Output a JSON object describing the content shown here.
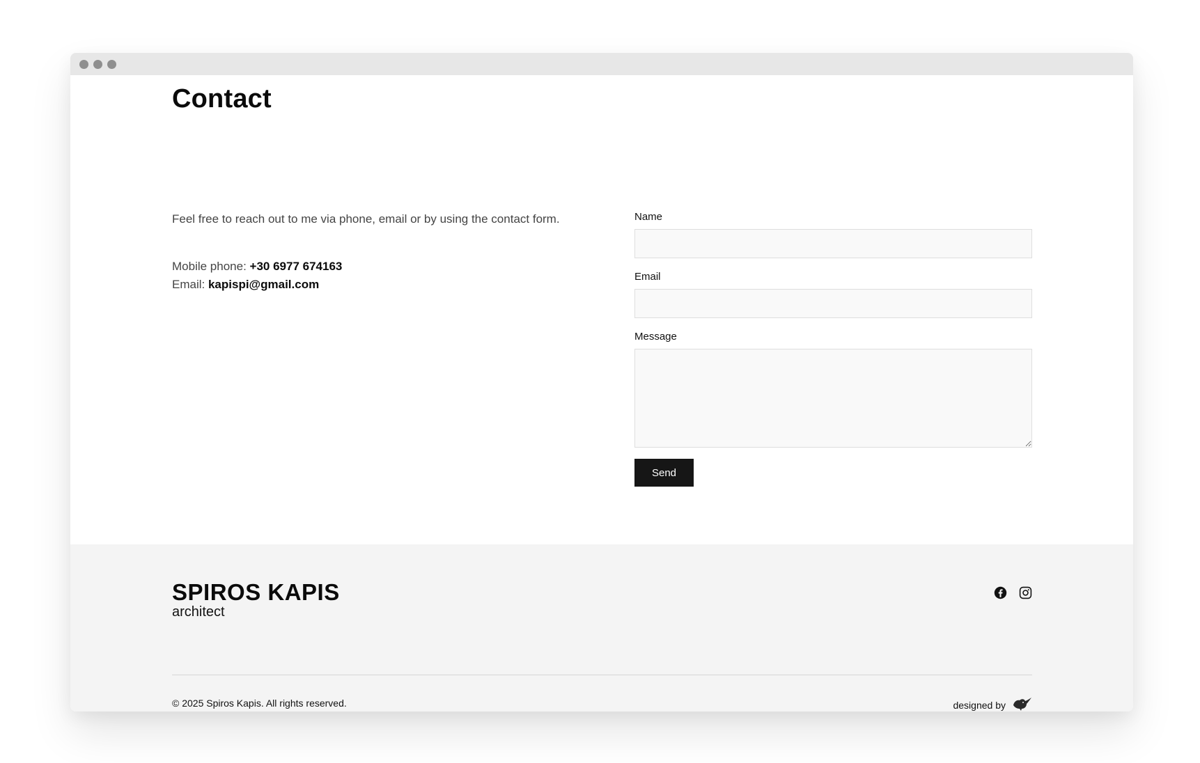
{
  "page": {
    "title": "Contact",
    "intro": "Feel free to reach out to me via phone, email or by using the contact form.",
    "phone_label": "Mobile phone:",
    "phone_value": "+30 6977 674163",
    "email_label": "Email:",
    "email_value": "kapispi@gmail.com"
  },
  "form": {
    "name_label": "Name",
    "name_value": "",
    "email_label": "Email",
    "email_value": "",
    "message_label": "Message",
    "message_value": "",
    "send_label": "Send"
  },
  "footer": {
    "brand_name": "SPIROS KAPIS",
    "brand_sub": "architect",
    "socials": [
      "facebook-icon",
      "instagram-icon"
    ],
    "copyright": "© 2025 Spiros Kapis. All rights reserved.",
    "designed_by": "designed by",
    "designer_logo": "bird-logo-icon"
  },
  "colors": {
    "titlebar": "#e7e7e7",
    "footer_bg": "#f4f4f4",
    "button_bg": "#161616",
    "input_bg": "#f9f9f9"
  }
}
